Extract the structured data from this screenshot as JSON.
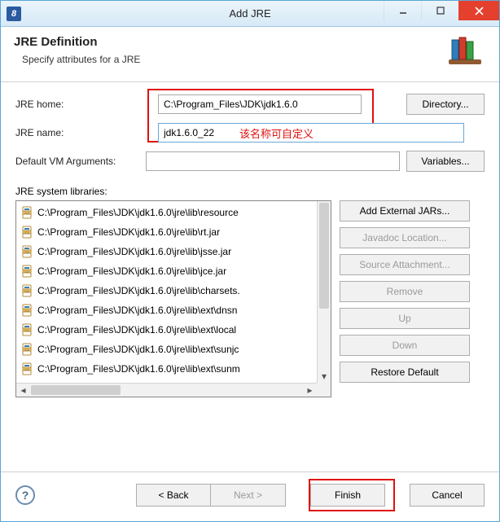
{
  "window": {
    "title": "Add JRE"
  },
  "header": {
    "title": "JRE Definition",
    "subtitle": "Specify attributes for a JRE"
  },
  "form": {
    "jre_home_label": "JRE home:",
    "jre_home_value": "C:\\Program_Files\\JDK\\jdk1.6.0",
    "directory_btn": "Directory...",
    "jre_name_label": "JRE name:",
    "jre_name_value": "jdk1.6.0_22",
    "jre_name_annotation": "该名称可自定义",
    "vm_args_label": "Default VM Arguments:",
    "vm_args_value": "",
    "variables_btn": "Variables...",
    "libraries_label": "JRE system libraries:"
  },
  "libraries": [
    "C:\\Program_Files\\JDK\\jdk1.6.0\\jre\\lib\\resource",
    "C:\\Program_Files\\JDK\\jdk1.6.0\\jre\\lib\\rt.jar",
    "C:\\Program_Files\\JDK\\jdk1.6.0\\jre\\lib\\jsse.jar",
    "C:\\Program_Files\\JDK\\jdk1.6.0\\jre\\lib\\jce.jar",
    "C:\\Program_Files\\JDK\\jdk1.6.0\\jre\\lib\\charsets.",
    "C:\\Program_Files\\JDK\\jdk1.6.0\\jre\\lib\\ext\\dnsn",
    "C:\\Program_Files\\JDK\\jdk1.6.0\\jre\\lib\\ext\\local",
    "C:\\Program_Files\\JDK\\jdk1.6.0\\jre\\lib\\ext\\sunjc",
    "C:\\Program_Files\\JDK\\jdk1.6.0\\jre\\lib\\ext\\sunm"
  ],
  "lib_buttons": {
    "add_external": "Add External JARs...",
    "javadoc": "Javadoc Location...",
    "source": "Source Attachment...",
    "remove": "Remove",
    "up": "Up",
    "down": "Down",
    "restore": "Restore Default"
  },
  "footer": {
    "back": "< Back",
    "next": "Next >",
    "finish": "Finish",
    "cancel": "Cancel"
  }
}
